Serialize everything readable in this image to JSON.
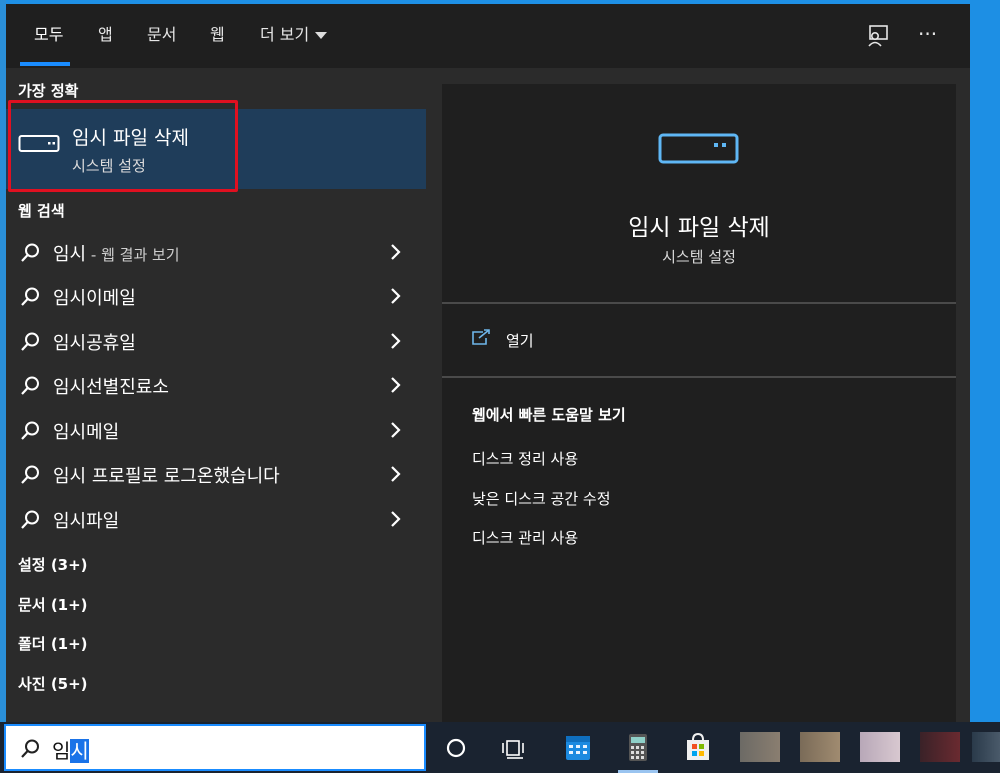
{
  "tabs": [
    {
      "label": "모두",
      "active": true
    },
    {
      "label": "앱"
    },
    {
      "label": "문서"
    },
    {
      "label": "웹"
    },
    {
      "label": "더 보기"
    }
  ],
  "icons": {
    "feedback": "feedback-icon",
    "more": "more-options-icon",
    "drive": "drive-icon",
    "search": "search-icon",
    "chevron": "chevron-right-icon",
    "open": "open-external-icon"
  },
  "more_options_glyph": "···",
  "best_match": {
    "section_title": "가장 정확",
    "title": "임시 파일 삭제",
    "subtitle": "시스템 설정"
  },
  "web_search": {
    "section_title": "웹 검색",
    "items": [
      {
        "text": "임시",
        "suffix": " - 웹 결과 보기"
      },
      {
        "text": "임시이메일",
        "suffix": ""
      },
      {
        "text": "임시공휴일",
        "suffix": ""
      },
      {
        "text": "임시선별진료소",
        "suffix": ""
      },
      {
        "text": "임시메일",
        "suffix": ""
      },
      {
        "text": "임시 프로필로 로그온했습니다",
        "suffix": ""
      },
      {
        "text": "임시파일",
        "suffix": ""
      }
    ]
  },
  "categories": [
    {
      "label": "설정 (3+)"
    },
    {
      "label": "문서 (1+)"
    },
    {
      "label": "폴더 (1+)"
    },
    {
      "label": "사진 (5+)"
    }
  ],
  "detail": {
    "title": "임시 파일 삭제",
    "subtitle": "시스템 설정",
    "open_label": "열기",
    "help_title": "웹에서 빠른 도움말 보기",
    "help_links": [
      "디스크 정리 사용",
      "낮은 디스크 공간 수정",
      "디스크 관리 사용"
    ]
  },
  "search": {
    "typed_before": "임",
    "typed_selected": "시"
  },
  "colors": {
    "accent": "#1a8cff",
    "highlight_outline": "#e01020",
    "best_match_bg": "#1f3d5a",
    "icon_blue": "#5fb7f5"
  }
}
